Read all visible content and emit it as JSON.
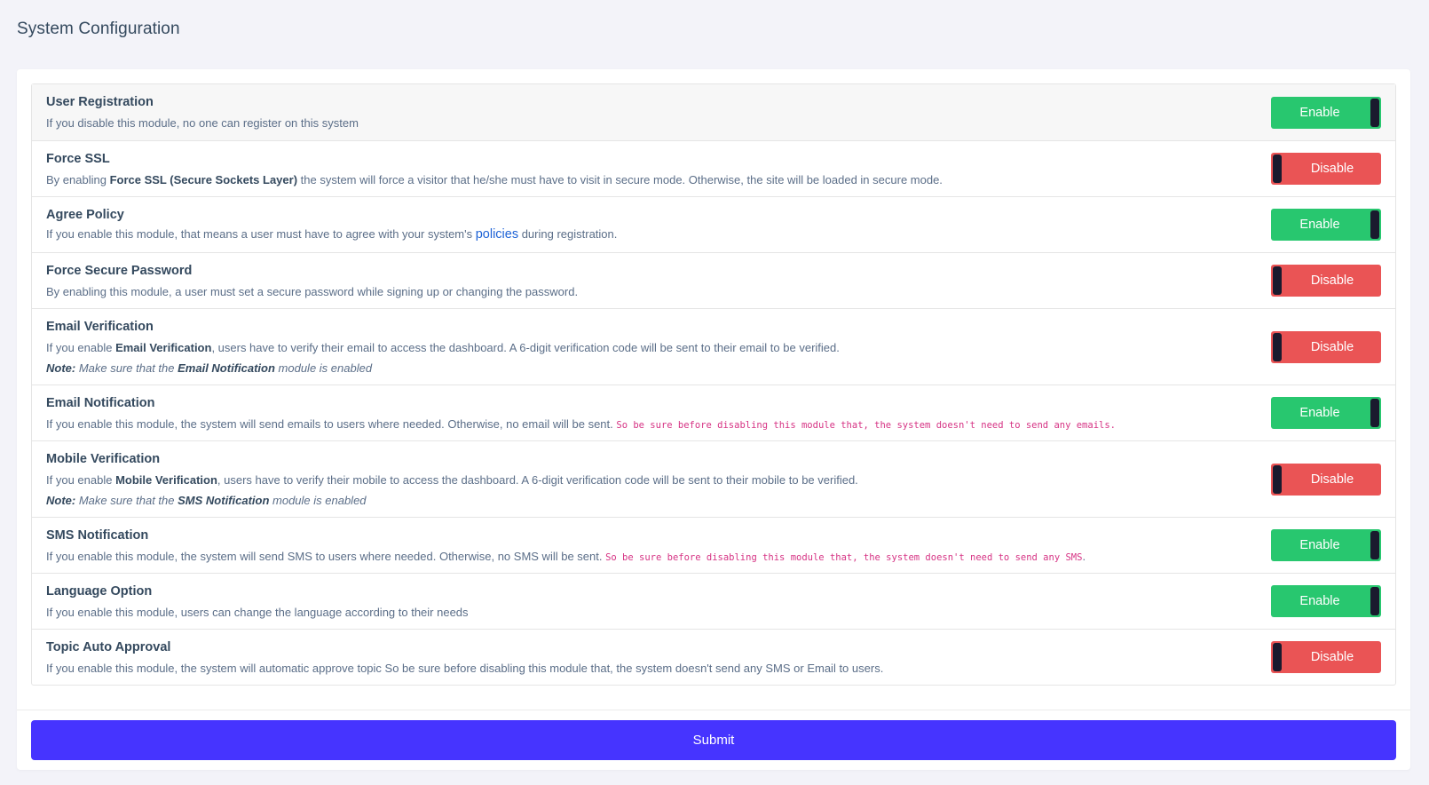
{
  "page": {
    "title": "System Configuration"
  },
  "settings": {
    "user_registration": {
      "title": "User Registration",
      "desc": "If you disable this module, no one can register on this system",
      "state": "Enable"
    },
    "force_ssl": {
      "title": "Force SSL",
      "desc_pre": "By enabling ",
      "desc_bold": "Force SSL (Secure Sockets Layer)",
      "desc_post": " the system will force a visitor that he/she must have to visit in secure mode. Otherwise, the site will be loaded in secure mode.",
      "state": "Disable"
    },
    "agree_policy": {
      "title": "Agree Policy",
      "desc_pre": "If you enable this module, that means a user must have to agree with your system's ",
      "link": "policies",
      "desc_post": " during registration.",
      "state": "Enable"
    },
    "force_secure_password": {
      "title": "Force Secure Password",
      "desc": "By enabling this module, a user must set a secure password while signing up or changing the password.",
      "state": "Disable"
    },
    "email_verification": {
      "title": "Email Verification",
      "desc_pre": "If you enable ",
      "desc_bold": "Email Verification",
      "desc_post": ", users have to verify their email to access the dashboard. A 6-digit verification code will be sent to their email to be verified.",
      "note_label": "Note:",
      "note_pre": " Make sure that the ",
      "note_bold": "Email Notification",
      "note_post": " module is enabled",
      "state": "Disable"
    },
    "email_notification": {
      "title": "Email Notification",
      "desc": "If you enable this module, the system will send emails to users where needed. Otherwise, no email will be sent. ",
      "code": "So be sure before disabling this module that, the system doesn't need to send any emails.",
      "state": "Enable"
    },
    "mobile_verification": {
      "title": "Mobile Verification",
      "desc_pre": "If you enable ",
      "desc_bold": "Mobile Verification",
      "desc_post": ", users have to verify their mobile to access the dashboard. A 6-digit verification code will be sent to their mobile to be verified.",
      "note_label": "Note:",
      "note_pre": " Make sure that the ",
      "note_bold": "SMS Notification",
      "note_post": " module is enabled",
      "state": "Disable"
    },
    "sms_notification": {
      "title": "SMS Notification",
      "desc": "If you enable this module, the system will send SMS to users where needed. Otherwise, no SMS will be sent. ",
      "code": "So be sure before disabling this module that, the system doesn't need to send any SMS",
      "code_end": ".",
      "state": "Enable"
    },
    "language_option": {
      "title": "Language Option",
      "desc": "If you enable this module, users can change the language according to their needs",
      "state": "Enable"
    },
    "topic_auto_approval": {
      "title": "Topic Auto Approval",
      "desc": "If you enable this module, the system will automatic approve topic So be sure before disabling this module that, the system doesn't send any SMS or Email to users.",
      "state": "Disable"
    }
  },
  "actions": {
    "submit_label": "Submit"
  },
  "colors": {
    "enable": "#28c76f",
    "disable": "#ea5455",
    "primary": "#4634ff",
    "link": "#1e63d6",
    "code": "#d63384"
  }
}
